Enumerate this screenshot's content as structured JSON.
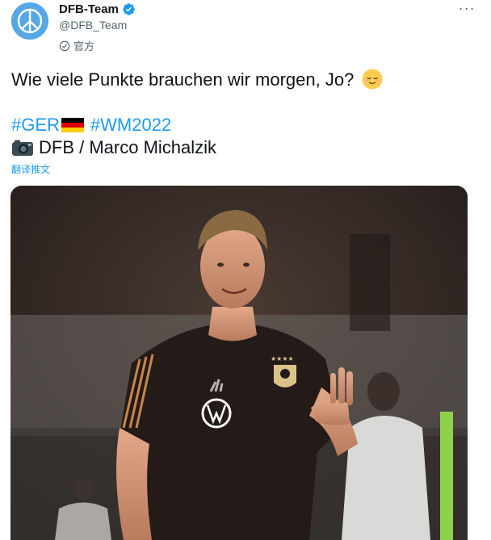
{
  "header": {
    "display_name": "DFB-Team",
    "handle": "@DFB_Team",
    "official_label": "官方",
    "avatar_icon": "peace-sign-icon",
    "verified_icon": "verified-badge-icon",
    "more_icon": "more-dots-icon",
    "more_glyph": "···"
  },
  "tweet": {
    "text": "Wie viele Punkte brauchen wir morgen, Jo?",
    "hashtag_ger": "#GER",
    "hashtag_wm": "#WM2022",
    "credit": "DFB / Marco Michalzik",
    "translate_label": "翻译推文",
    "emoji_face": "relieved-face-emoji",
    "flag": "germany-flag-emoji",
    "camera": "camera-emoji"
  },
  "photo": {
    "description_icon": "photo-football-player"
  },
  "colors": {
    "link": "#1d9bf0",
    "verified": "#1d9bf0",
    "secondary_text": "#536471",
    "avatar_bg": "#55a7e6"
  }
}
